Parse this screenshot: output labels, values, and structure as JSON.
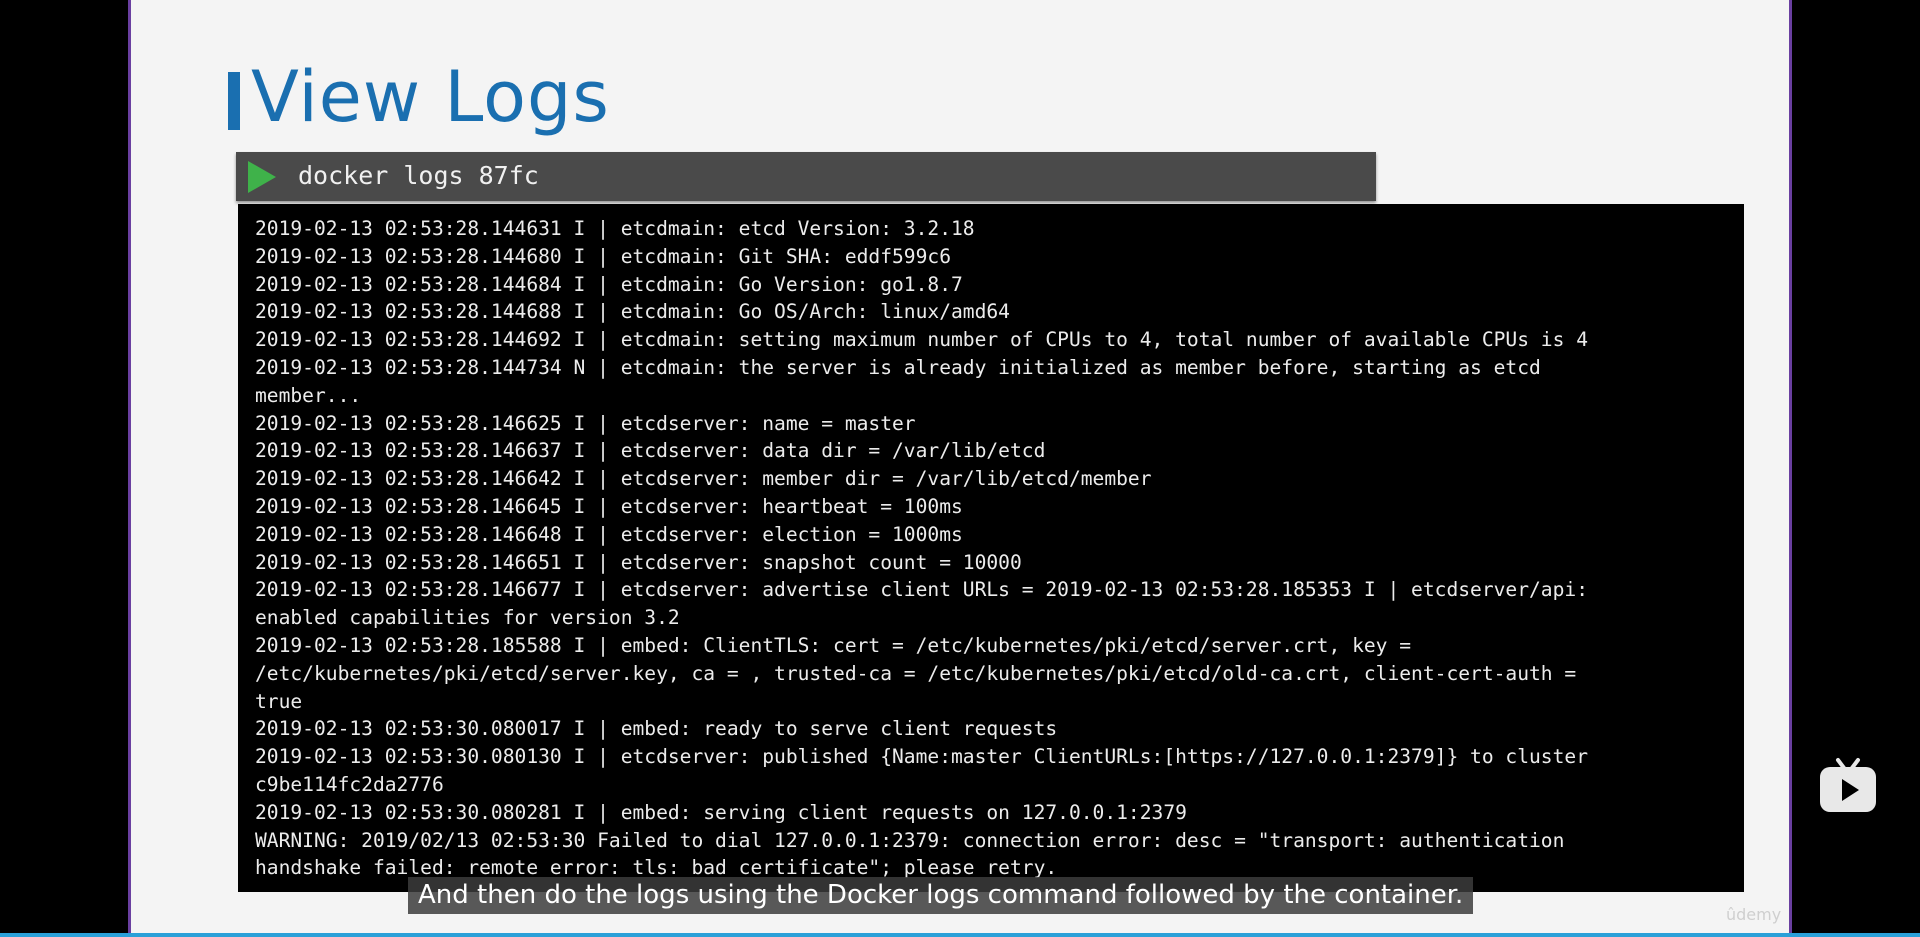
{
  "slide": {
    "title": "View Logs",
    "command": "docker logs 87fc"
  },
  "terminal": {
    "lines": [
      "2019-02-13 02:53:28.144631 I | etcdmain: etcd Version: 3.2.18",
      "2019-02-13 02:53:28.144680 I | etcdmain: Git SHA: eddf599c6",
      "2019-02-13 02:53:28.144684 I | etcdmain: Go Version: go1.8.7",
      "2019-02-13 02:53:28.144688 I | etcdmain: Go OS/Arch: linux/amd64",
      "2019-02-13 02:53:28.144692 I | etcdmain: setting maximum number of CPUs to 4, total number of available CPUs is 4",
      "2019-02-13 02:53:28.144734 N | etcdmain: the server is already initialized as member before, starting as etcd",
      "member...",
      "2019-02-13 02:53:28.146625 I | etcdserver: name = master",
      "2019-02-13 02:53:28.146637 I | etcdserver: data dir = /var/lib/etcd",
      "2019-02-13 02:53:28.146642 I | etcdserver: member dir = /var/lib/etcd/member",
      "2019-02-13 02:53:28.146645 I | etcdserver: heartbeat = 100ms",
      "2019-02-13 02:53:28.146648 I | etcdserver: election = 1000ms",
      "2019-02-13 02:53:28.146651 I | etcdserver: snapshot count = 10000",
      "2019-02-13 02:53:28.146677 I | etcdserver: advertise client URLs = 2019-02-13 02:53:28.185353 I | etcdserver/api:",
      "enabled capabilities for version 3.2",
      "2019-02-13 02:53:28.185588 I | embed: ClientTLS: cert = /etc/kubernetes/pki/etcd/server.crt, key =",
      "/etc/kubernetes/pki/etcd/server.key, ca = , trusted-ca = /etc/kubernetes/pki/etcd/old-ca.crt, client-cert-auth =",
      "true",
      "2019-02-13 02:53:30.080017 I | embed: ready to serve client requests",
      "2019-02-13 02:53:30.080130 I | etcdserver: published {Name:master ClientURLs:[https://127.0.0.1:2379]} to cluster",
      "c9be114fc2da2776",
      "2019-02-13 02:53:30.080281 I | embed: serving client requests on 127.0.0.1:2379",
      "WARNING: 2019/02/13 02:53:30 Failed to dial 127.0.0.1:2379: connection error: desc = \"transport: authentication",
      "handshake failed: remote error: tls: bad certificate\"; please retry."
    ]
  },
  "caption": {
    "text": "And then do the logs using the Docker logs command followed by the container."
  },
  "watermark": {
    "text": "ûdemy"
  },
  "icons": {
    "play": "play-icon",
    "player": "tv-player-icon"
  },
  "colors": {
    "title": "#1a6fb0",
    "play_green": "#3fb24a",
    "command_bar": "#4a4a4a",
    "terminal_bg": "#000000",
    "slide_border": "#6a3fa0",
    "progress": "#2aa0d8"
  }
}
